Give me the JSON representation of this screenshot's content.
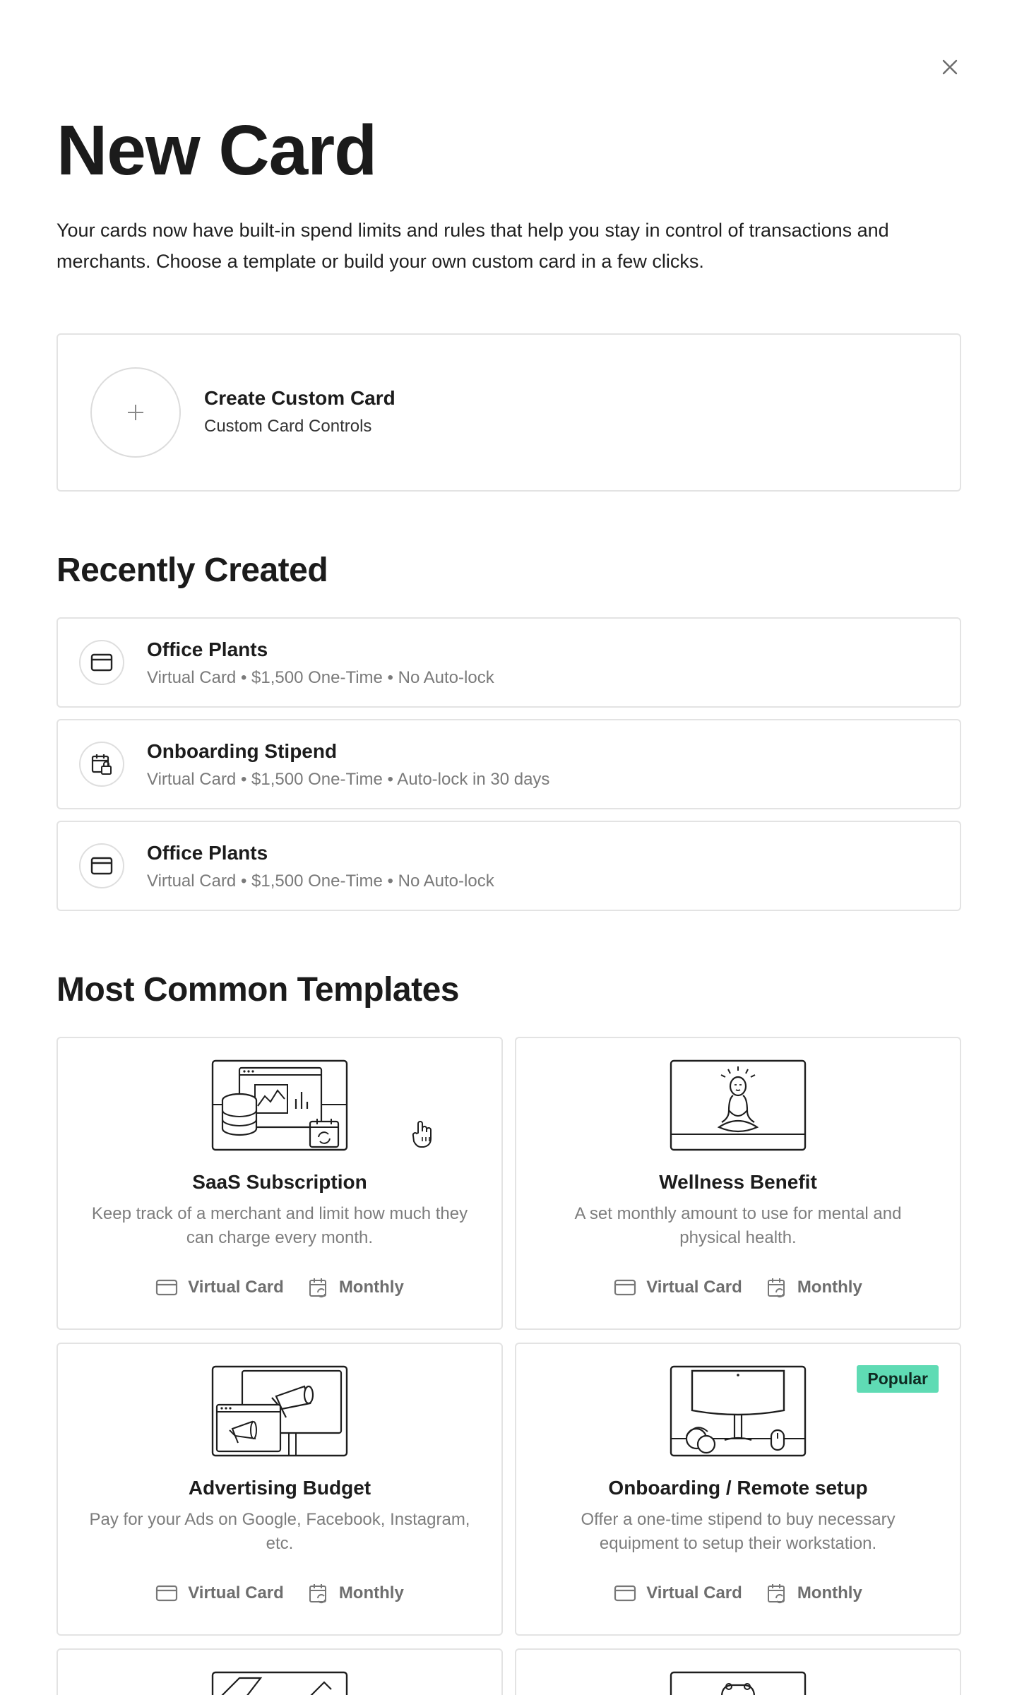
{
  "modal": {
    "title": "New Card",
    "description": "Your cards now have built-in spend limits and rules that help you stay in control of transactions and merchants. Choose a template or build your own custom card in a few clicks.",
    "close_icon": "close-icon"
  },
  "custom_card": {
    "title": "Create Custom Card",
    "subtitle": "Custom Card Controls",
    "icon": "plus-icon"
  },
  "recent": {
    "heading": "Recently Created",
    "items": [
      {
        "name": "Office Plants",
        "meta": "Virtual Card • $1,500 One-Time • No Auto-lock",
        "icon": "credit-card-icon"
      },
      {
        "name": "Onboarding Stipend",
        "meta": "Virtual Card • $1,500 One-Time • Auto-lock in 30 days",
        "icon": "calendar-lock-icon"
      },
      {
        "name": "Office Plants",
        "meta": "Virtual Card • $1,500 One-Time • No Auto-lock",
        "icon": "credit-card-icon"
      }
    ]
  },
  "templates": {
    "heading": "Most Common Templates",
    "items": [
      {
        "title": "SaaS Subscription",
        "description": "Keep track of a merchant and limit how much they can charge every month.",
        "card_type": "Virtual Card",
        "frequency": "Monthly",
        "illustration": "saas-dashboard-illustration"
      },
      {
        "title": "Wellness Benefit",
        "description": "A set monthly amount to use for mental and physical health.",
        "card_type": "Virtual Card",
        "frequency": "Monthly",
        "illustration": "meditation-illustration"
      },
      {
        "title": "Advertising Budget",
        "description": "Pay for your Ads on Google, Facebook, Instagram, etc.",
        "card_type": "Virtual Card",
        "frequency": "Monthly",
        "illustration": "megaphone-illustration"
      },
      {
        "title": "Onboarding / Remote setup",
        "description": "Offer a one-time stipend to buy necessary equipment to setup their workstation.",
        "card_type": "Virtual Card",
        "frequency": "Monthly",
        "illustration": "workstation-illustration",
        "badge": "Popular"
      }
    ]
  },
  "colors": {
    "text": "#1b1b1b",
    "muted": "#7d7d7d",
    "border": "#e3e3e3",
    "badge": "#5fdbb4"
  }
}
